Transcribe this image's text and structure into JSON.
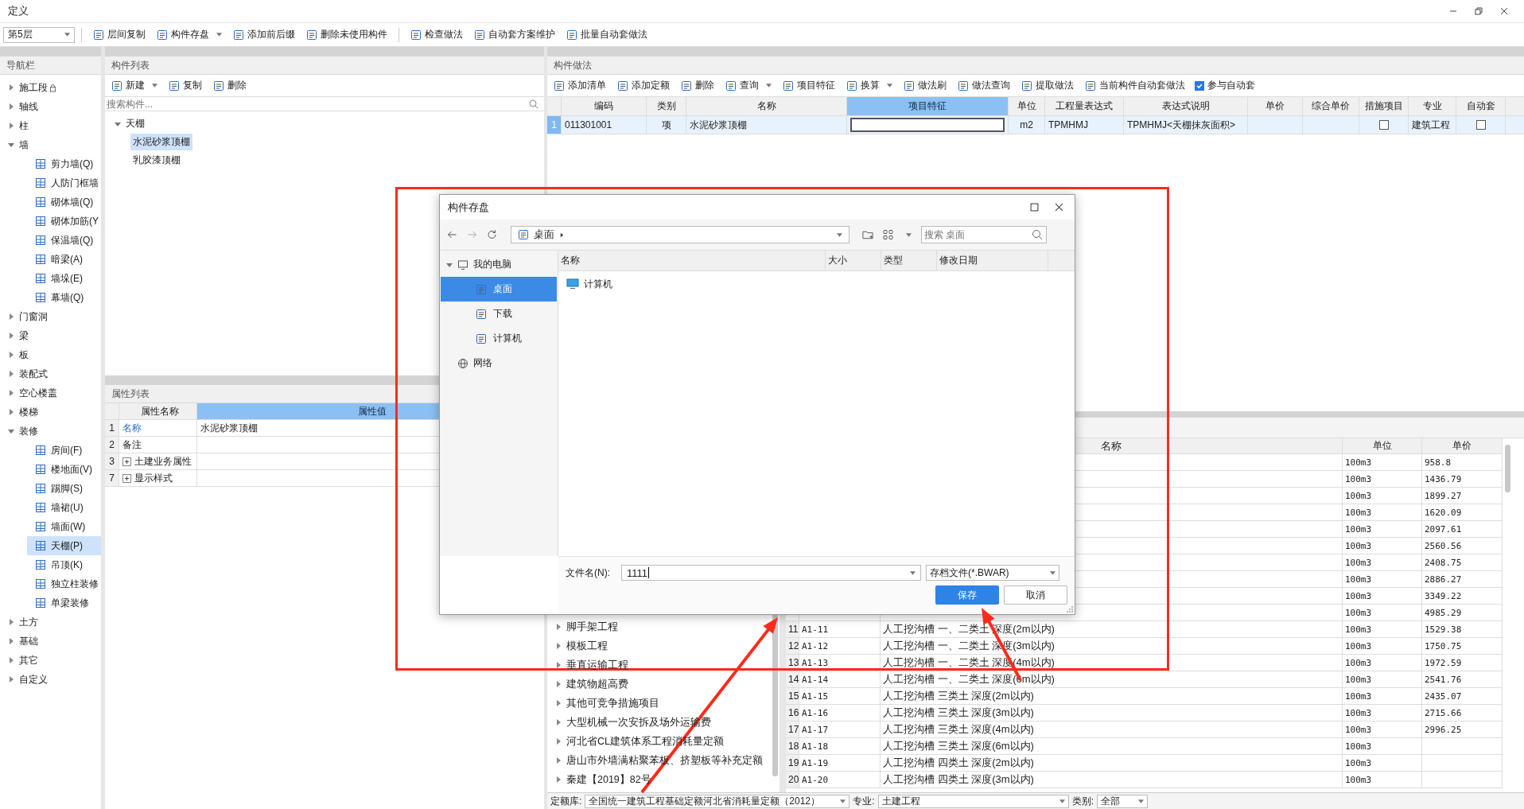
{
  "window": {
    "title": "定义"
  },
  "toolbar": {
    "floor_select": "第5层",
    "buttons": [
      {
        "label": "层间复制",
        "dropdown": false
      },
      {
        "label": "构件存盘",
        "dropdown": true
      },
      {
        "label": "添加前后缀",
        "dropdown": false
      },
      {
        "label": "删除未使用构件",
        "dropdown": false
      },
      {
        "label": "检查做法",
        "dropdown": false
      },
      {
        "label": "自动套方案维护",
        "dropdown": false
      },
      {
        "label": "批量自动套做法",
        "dropdown": false
      }
    ]
  },
  "nav": {
    "title": "导航栏",
    "items": [
      {
        "label": "施工段",
        "expanded": false,
        "locked": true
      },
      {
        "label": "轴线",
        "expanded": false,
        "locked": false
      },
      {
        "label": "柱",
        "expanded": false,
        "locked": false
      },
      {
        "label": "墙",
        "expanded": true,
        "locked": false,
        "children": [
          {
            "label": "剪力墙(Q)",
            "selected": false
          },
          {
            "label": "人防门框墙",
            "selected": false
          },
          {
            "label": "砌体墙(Q)",
            "selected": false
          },
          {
            "label": "砌体加筋(Y",
            "selected": false
          },
          {
            "label": "保温墙(Q)",
            "selected": false
          },
          {
            "label": "暗梁(A)",
            "selected": false
          },
          {
            "label": "墙垛(E)",
            "selected": false
          },
          {
            "label": "幕墙(Q)",
            "selected": false
          }
        ]
      },
      {
        "label": "门窗洞",
        "expanded": false,
        "locked": false
      },
      {
        "label": "梁",
        "expanded": false,
        "locked": false
      },
      {
        "label": "板",
        "expanded": false,
        "locked": false
      },
      {
        "label": "装配式",
        "expanded": false,
        "locked": false
      },
      {
        "label": "空心楼盖",
        "expanded": false,
        "locked": false
      },
      {
        "label": "楼梯",
        "expanded": false,
        "locked": false
      },
      {
        "label": "装修",
        "expanded": true,
        "locked": false,
        "children": [
          {
            "label": "房间(F)",
            "selected": false
          },
          {
            "label": "楼地面(V)",
            "selected": false
          },
          {
            "label": "踢脚(S)",
            "selected": false
          },
          {
            "label": "墙裙(U)",
            "selected": false
          },
          {
            "label": "墙面(W)",
            "selected": false
          },
          {
            "label": "天棚(P)",
            "selected": true
          },
          {
            "label": "吊顶(K)",
            "selected": false
          },
          {
            "label": "独立柱装修",
            "selected": false
          },
          {
            "label": "单梁装修",
            "selected": false
          }
        ]
      },
      {
        "label": "土方",
        "expanded": false,
        "locked": false
      },
      {
        "label": "基础",
        "expanded": false,
        "locked": false
      },
      {
        "label": "其它",
        "expanded": false,
        "locked": false
      },
      {
        "label": "自定义",
        "expanded": false,
        "locked": false
      }
    ]
  },
  "component_list": {
    "title": "构件列表",
    "buttons": [
      {
        "label": "新建",
        "dropdown": true
      },
      {
        "label": "复制",
        "dropdown": false
      },
      {
        "label": "删除",
        "dropdown": false
      }
    ],
    "search": {
      "placeholder": "搜索构件..."
    },
    "tree": [
      {
        "label": "天棚",
        "expanded": true,
        "children": [
          {
            "label": "水泥砂浆顶棚",
            "selected": true
          },
          {
            "label": "乳胶漆顶棚",
            "selected": false
          }
        ]
      }
    ]
  },
  "property_list": {
    "title": "属性列表",
    "columns": [
      {
        "label": "属性名称",
        "selected": false
      },
      {
        "label": "属性值",
        "selected": true
      }
    ],
    "rows": [
      {
        "num": "1",
        "name": "名称",
        "value": "水泥砂浆顶棚",
        "kind": "link"
      },
      {
        "num": "2",
        "name": "备注",
        "kind": "plain"
      },
      {
        "num": "3",
        "name": "土建业务属性",
        "kind": "group"
      },
      {
        "num": "7",
        "name": "显示样式",
        "kind": "group"
      }
    ]
  },
  "method": {
    "title": "构件做法",
    "buttons": [
      {
        "label": "添加清单",
        "dropdown": false
      },
      {
        "label": "添加定额",
        "dropdown": false
      },
      {
        "label": "删除",
        "dropdown": false
      },
      {
        "label": "查询",
        "dropdown": true
      },
      {
        "label": "项目特征",
        "dropdown": false
      },
      {
        "label": "换算",
        "dropdown": true
      },
      {
        "label": "做法刷",
        "dropdown": false
      },
      {
        "label": "做法查询",
        "dropdown": false
      },
      {
        "label": "提取做法",
        "dropdown": false
      },
      {
        "label": "当前构件自动套做法",
        "dropdown": false
      }
    ],
    "auto_checkbox": {
      "label": "参与自动套",
      "checked": true
    },
    "columns": [
      {
        "label": "编码",
        "selected": false
      },
      {
        "label": "类别",
        "selected": false
      },
      {
        "label": "名称",
        "selected": false
      },
      {
        "label": "项目特征",
        "selected": true
      },
      {
        "label": "单位",
        "selected": false
      },
      {
        "label": "工程量表达式",
        "selected": false
      },
      {
        "label": "表达式说明",
        "selected": false
      },
      {
        "label": "单价",
        "selected": false
      },
      {
        "label": "综合单价",
        "selected": false
      },
      {
        "label": "措施项目",
        "selected": false
      },
      {
        "label": "专业",
        "selected": false
      },
      {
        "label": "自动套",
        "selected": false
      }
    ],
    "rows": [
      {
        "num": "1",
        "selected": true,
        "cells": [
          {
            "kind": "text",
            "text": "011301001"
          },
          {
            "kind": "center",
            "text": "项"
          },
          {
            "kind": "text",
            "text": "水泥砂浆顶棚"
          },
          {
            "kind": "focus"
          },
          {
            "kind": "center",
            "text": "m2"
          },
          {
            "kind": "text",
            "text": "TPMHMJ"
          },
          {
            "kind": "text",
            "text": "TPMHMJ<天棚抹灰面积>"
          },
          {
            "kind": "empty"
          },
          {
            "kind": "empty"
          },
          {
            "kind": "checkbox",
            "checked": false
          },
          {
            "kind": "text",
            "text": "建筑工程"
          },
          {
            "kind": "checkbox",
            "checked": false
          }
        ]
      }
    ]
  },
  "quota": {
    "tree": [
      "脚手架工程",
      "模板工程",
      "垂直运输工程",
      "建筑物超高费",
      "其他可竞争措施项目",
      "大型机械一次安拆及场外运输费",
      "河北省CL建筑体系工程消耗量定额",
      "唐山市外墙满粘聚苯板、挤塑板等补充定额",
      "秦建【2019】82号"
    ],
    "columns": [
      "名称",
      "单位",
      "单价"
    ],
    "rows": [
      {
        "unit": "100m3",
        "price": "958.8"
      },
      {
        "unit": "100m3",
        "price": "1436.79"
      },
      {
        "unit": "100m3",
        "price": "1899.27"
      },
      {
        "unit": "100m3",
        "price": "1620.09"
      },
      {
        "unit": "100m3",
        "price": "2097.61"
      },
      {
        "unit": "100m3",
        "price": "2560.56"
      },
      {
        "unit": "100m3",
        "price": "2408.75"
      },
      {
        "unit": "100m3",
        "price": "2886.27"
      },
      {
        "unit": "100m3",
        "price": "3349.22"
      },
      {
        "unit": "100m3",
        "price": "4985.29"
      },
      {
        "num": "11",
        "code": "A1-11",
        "name": "人工挖沟槽 一、二类土 深度(2m以内)",
        "unit": "100m3",
        "price": "1529.38"
      },
      {
        "num": "12",
        "code": "A1-12",
        "name": "人工挖沟槽 一、二类土 深度(3m以内)",
        "unit": "100m3",
        "price": "1750.75"
      },
      {
        "num": "13",
        "code": "A1-13",
        "name": "人工挖沟槽 一、二类土 深度(4m以内)",
        "unit": "100m3",
        "price": "1972.59"
      },
      {
        "num": "14",
        "code": "A1-14",
        "name": "人工挖沟槽 一、二类土 深度(6m以内)",
        "unit": "100m3",
        "price": "2541.76"
      },
      {
        "num": "15",
        "code": "A1-15",
        "name": "人工挖沟槽 三类土 深度(2m以内)",
        "unit": "100m3",
        "price": "2435.07"
      },
      {
        "num": "16",
        "code": "A1-16",
        "name": "人工挖沟槽 三类土 深度(3m以内)",
        "unit": "100m3",
        "price": "2715.66"
      },
      {
        "num": "17",
        "code": "A1-17",
        "name": "人工挖沟槽 三类土 深度(4m以内)",
        "unit": "100m3",
        "price": "2996.25"
      },
      {
        "num": "18",
        "code": "A1-18",
        "name": "人工挖沟槽 三类土 深度(6m以内)",
        "unit": "100m3"
      },
      {
        "num": "19",
        "code": "A1-19",
        "name": "人工挖沟槽 四类土 深度(2m以内)",
        "unit": "100m3"
      },
      {
        "num": "20",
        "code": "A1-20",
        "name": "人工挖沟槽 四类土 深度(3m以内)",
        "unit": "100m3"
      }
    ],
    "bottom": {
      "library_label": "定额库:",
      "library": "全国统一建筑工程基础定额河北省消耗量定额（2012）",
      "major_label": "专业:",
      "major": "土建工程",
      "category_label": "类别:",
      "category": "全部"
    }
  },
  "dialog": {
    "title": "构件存盘",
    "path": "桌面",
    "search": {
      "placeholder": "搜索 桌面"
    },
    "places": [
      {
        "label": "我的电脑",
        "expanded": true,
        "children": [
          {
            "label": "桌面",
            "selected": true
          },
          {
            "label": "下载",
            "selected": false
          },
          {
            "label": "计算机",
            "selected": false
          }
        ]
      },
      {
        "label": "网络"
      }
    ],
    "columns": [
      "名称",
      "大小",
      "类型",
      "修改日期"
    ],
    "files": [
      {
        "name": "计算机"
      }
    ],
    "filename_label": "文件名(N):",
    "filename": "1111",
    "filetype": "存档文件(*.BWAR)",
    "buttons": [
      {
        "label": "保存",
        "kind": "primary"
      },
      {
        "label": "取消",
        "kind": "normal"
      }
    ]
  },
  "annotations": [
    {
      "kind": "frame"
    },
    {
      "kind": "arrow"
    },
    {
      "kind": "arrow"
    }
  ]
}
